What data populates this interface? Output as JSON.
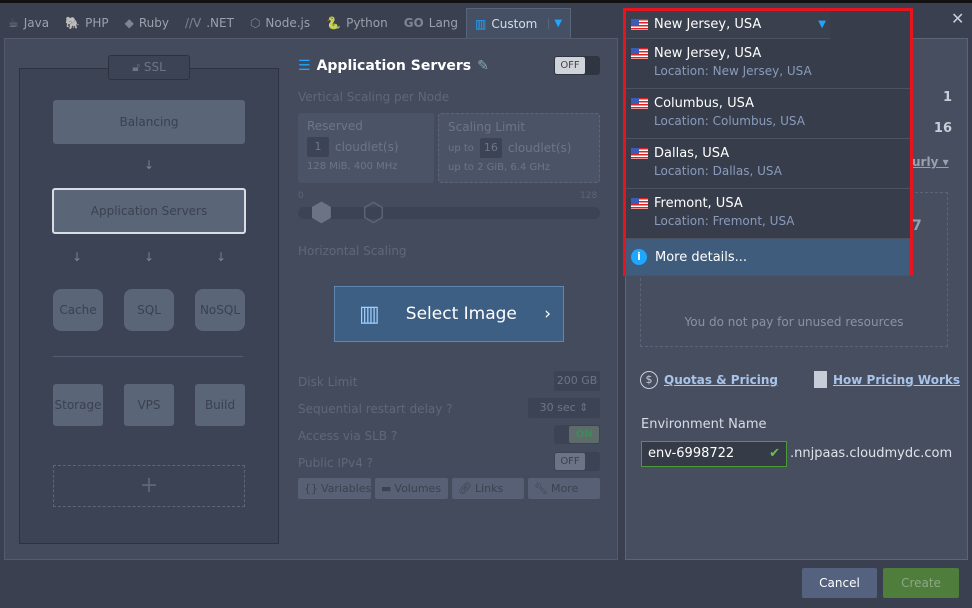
{
  "tabs": [
    {
      "label": "Java",
      "icon": "java-icon"
    },
    {
      "label": "PHP",
      "icon": "php-icon"
    },
    {
      "label": "Ruby",
      "icon": "ruby-icon"
    },
    {
      "label": ".NET",
      "icon": "dotnet-icon"
    },
    {
      "label": "Node.js",
      "icon": "nodejs-icon"
    },
    {
      "label": "Python",
      "icon": "python-icon"
    },
    {
      "label": "Lang",
      "icon": "go-icon",
      "prefix": "GO"
    },
    {
      "label": "Custom",
      "icon": "custom-icon",
      "active": true
    }
  ],
  "topology": {
    "ssl": "SSL",
    "balancing": "Balancing",
    "app_servers": "Application Servers",
    "cache": "Cache",
    "sql": "SQL",
    "nosql": "NoSQL",
    "storage": "Storage",
    "vps": "VPS",
    "build": "Build",
    "add": "+"
  },
  "config": {
    "title": "Application Servers",
    "toggle": "OFF",
    "vertical_label": "Vertical Scaling per Node",
    "reserved_label": "Reserved",
    "reserved_value": "1",
    "cloudlets": "cloudlet(s)",
    "reserved_info": "128 MiB, 400 MHz",
    "limit_label": "Scaling Limit",
    "up_to": "up to",
    "limit_value": "16",
    "limit_info": "up to 2 GiB, 6.4 GHz",
    "slider_min": "0",
    "slider_max": "128",
    "horizontal_label": "Horizontal Scaling",
    "select_image": "Select Image",
    "disk_label": "Disk Limit",
    "disk_value": "200",
    "disk_unit": "GB",
    "restart_label": "Sequential restart delay",
    "restart_value": "30",
    "restart_unit": "sec",
    "slb_label": "Access via SLB",
    "slb_toggle": "ON",
    "ipv4_label": "Public IPv4",
    "ipv4_toggle": "OFF",
    "buttons": [
      "Variables",
      "Volumes",
      "Links",
      "More"
    ]
  },
  "region": {
    "selected": "New Jersey, USA",
    "options": [
      {
        "name": "New Jersey, USA",
        "location": "Location: New Jersey, USA"
      },
      {
        "name": "Columbus, USA",
        "location": "Location: Columbus, USA"
      },
      {
        "name": "Dallas, USA",
        "location": "Location: Dallas, USA"
      },
      {
        "name": "Fremont, USA",
        "location": "Location: Fremont, USA"
      }
    ],
    "more": "More details..."
  },
  "summary": {
    "reserved": "1",
    "limit": "16",
    "period": "urly",
    "price_tail": "7",
    "unused": "You do not pay for unused resources",
    "quotas": "Quotas & Pricing",
    "how": "How Pricing Works",
    "env_label": "Environment Name",
    "env_value": "env-6998722",
    "domain": ".nnjpaas.cloudmydc.com"
  },
  "footer": {
    "cancel": "Cancel",
    "create": "Create"
  },
  "colors": {
    "accent": "#1ea7ff",
    "highlight": "#e6141e",
    "create": "#4e7d3c",
    "cancel": "#546280"
  }
}
